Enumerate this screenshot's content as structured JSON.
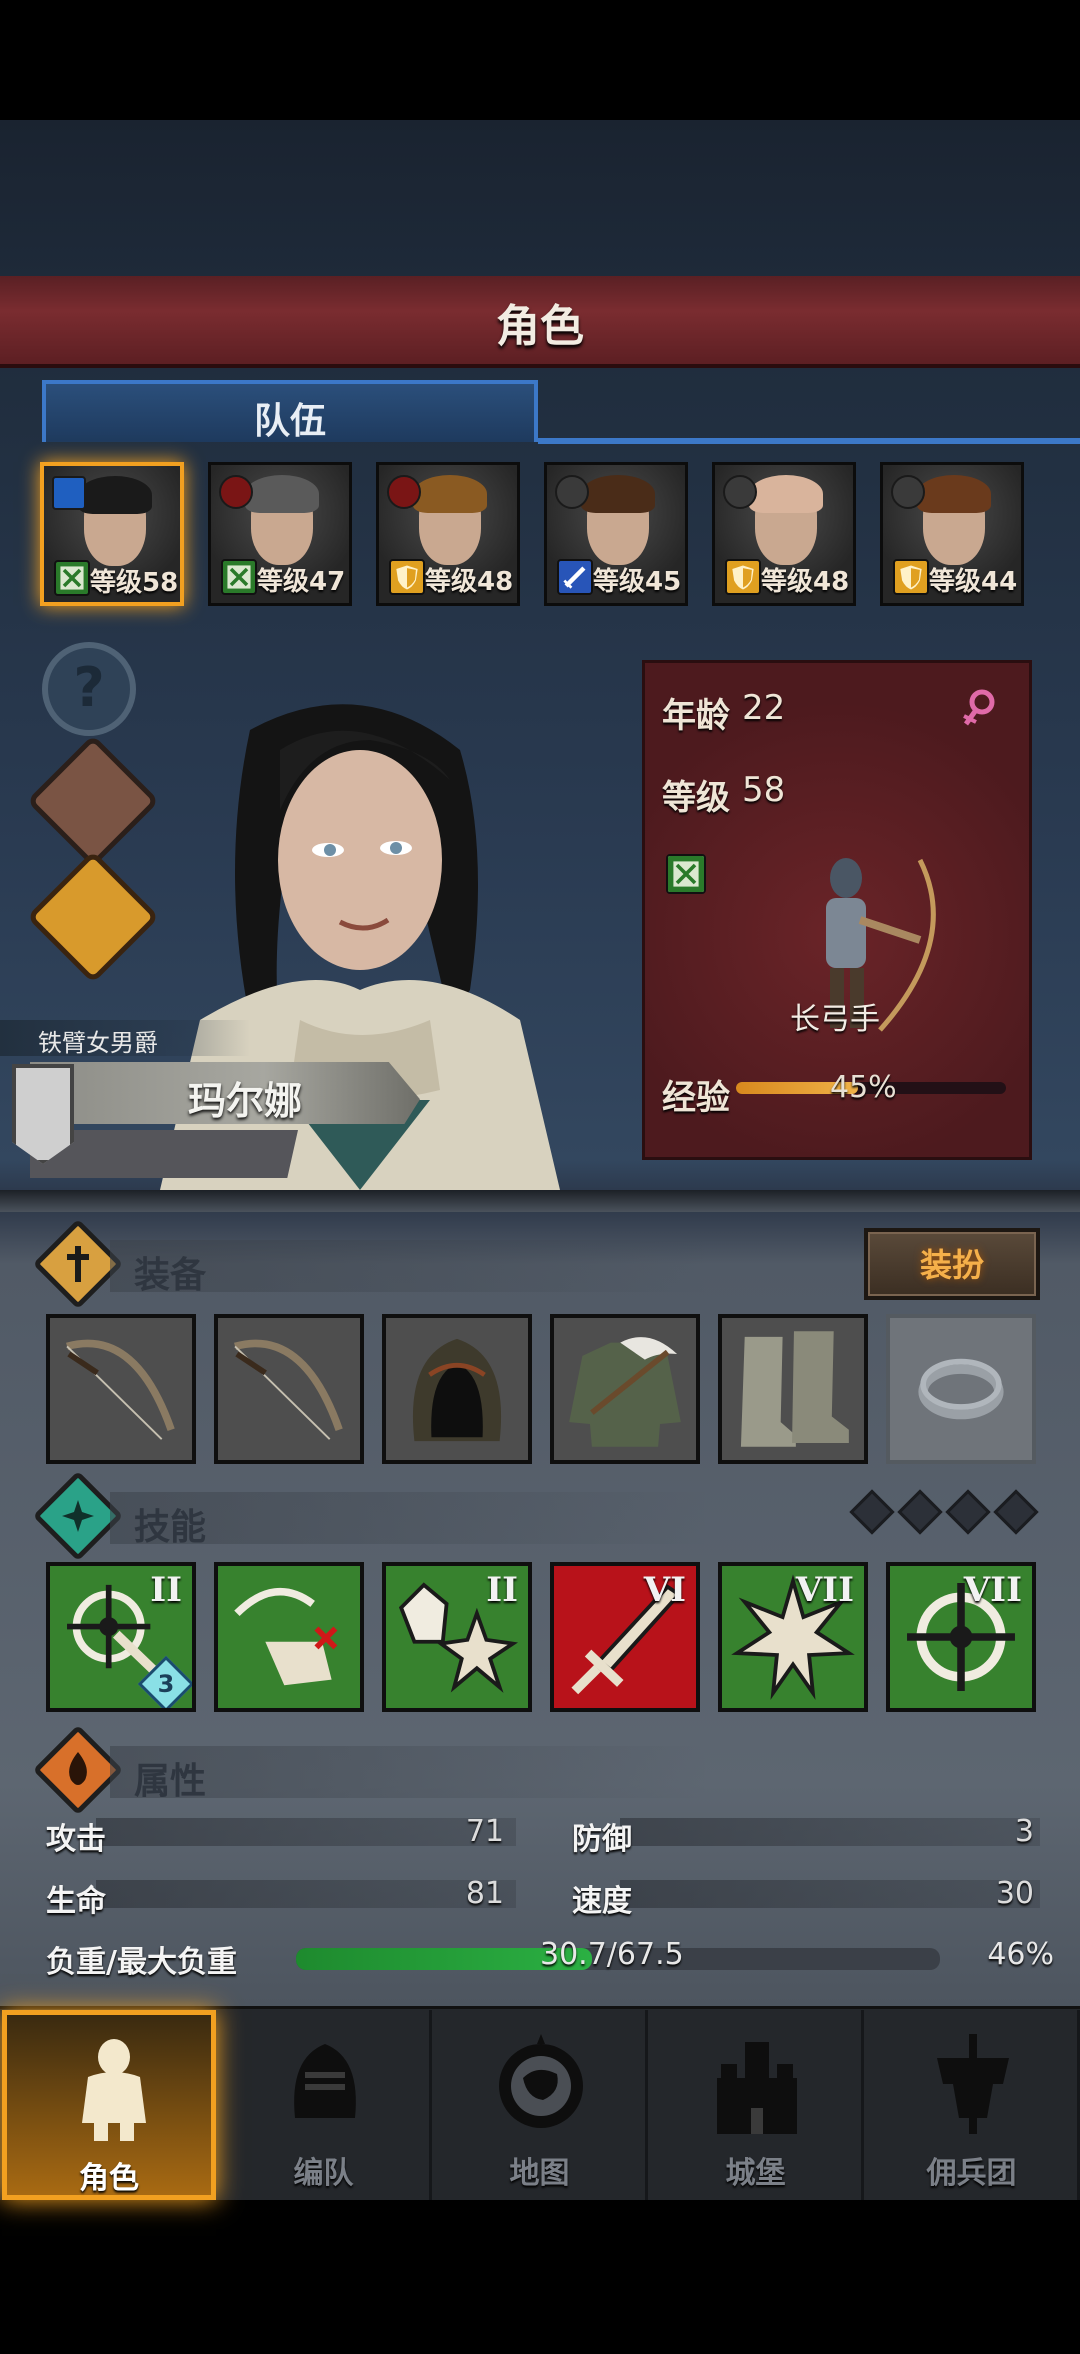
{
  "header": {
    "title": "角色"
  },
  "tabs": [
    {
      "label": "队伍",
      "active": true
    }
  ],
  "party": [
    {
      "level_prefix": "等级",
      "level": "58",
      "class_icon": "bow-icon",
      "class_color": "#2a7a2a",
      "role_icon": "flag-icon",
      "hair": "#1a1a1a",
      "selected": true
    },
    {
      "level_prefix": "等级",
      "level": "47",
      "class_icon": "bow-icon",
      "class_color": "#2a7a2a",
      "role_icon": "helmet-icon",
      "hair": "#5a5a5a"
    },
    {
      "level_prefix": "等级",
      "level": "48",
      "class_icon": "shield-icon",
      "class_color": "#e0a020",
      "role_icon": "helmet-icon",
      "hair": "#8a5a22"
    },
    {
      "level_prefix": "等级",
      "level": "45",
      "class_icon": "sword-icon",
      "class_color": "#2855b8",
      "role_icon": "helmet-icon",
      "hair": "#4a2c18"
    },
    {
      "level_prefix": "等级",
      "level": "48",
      "class_icon": "shield-icon",
      "class_color": "#e0a020",
      "role_icon": "helmet-icon",
      "hair": "#d9b49c"
    },
    {
      "level_prefix": "等级",
      "level": "44",
      "class_icon": "shield-icon",
      "class_color": "#e0a020",
      "role_icon": "helmet-icon",
      "hair": "#6a3a1c"
    }
  ],
  "character": {
    "title": "铁臂女男爵",
    "name": "玛尔娜",
    "age_label": "年龄",
    "age": "22",
    "level_label": "等级",
    "level": "58",
    "class_name": "长弓手",
    "exp_label": "经验",
    "exp_percent": "45%",
    "exp_fraction": 0.45,
    "gender_icon": "female-icon"
  },
  "equipment": {
    "title": "装备",
    "dress_button": "装扮",
    "slots": [
      {
        "item": "longbow-icon",
        "empty": false
      },
      {
        "item": "longbow-icon",
        "empty": false
      },
      {
        "item": "hood-icon",
        "empty": false
      },
      {
        "item": "tunic-icon",
        "empty": false
      },
      {
        "item": "boots-icon",
        "empty": false
      },
      {
        "item": "ring-icon",
        "empty": true
      }
    ]
  },
  "skills": {
    "title": "技能",
    "items": [
      {
        "icon": "aimed-shot-icon",
        "rank": "II",
        "count": "3",
        "color": "green"
      },
      {
        "icon": "stun-arrow-icon",
        "rank": "",
        "count": "",
        "color": "green"
      },
      {
        "icon": "gem-burst-icon",
        "rank": "II",
        "count": "",
        "color": "green"
      },
      {
        "icon": "dagger-icon",
        "rank": "VI",
        "count": "",
        "color": "red"
      },
      {
        "icon": "burst-icon",
        "rank": "VII",
        "count": "",
        "color": "green"
      },
      {
        "icon": "crosshair-icon",
        "rank": "VII",
        "count": "",
        "color": "green"
      }
    ]
  },
  "attributes": {
    "title": "属性",
    "attack_label": "攻击",
    "attack": "71",
    "defense_label": "防御",
    "defense": "3",
    "health_label": "生命",
    "health": "81",
    "speed_label": "速度",
    "speed": "30",
    "load_label": "负重/最大负重",
    "load_value": "30.7/67.5",
    "load_percent": "46%",
    "load_fraction": 0.46
  },
  "nav": [
    {
      "label": "角色",
      "icon": "knight-icon",
      "active": true
    },
    {
      "label": "编队",
      "icon": "helmet-icon",
      "active": false
    },
    {
      "label": "地图",
      "icon": "compass-map-icon",
      "active": false
    },
    {
      "label": "城堡",
      "icon": "castle-icon",
      "active": false
    },
    {
      "label": "佣兵团",
      "icon": "banner-icon",
      "active": false
    }
  ],
  "colors": {
    "accent": "#f2a020",
    "tab_blue": "#3c78c8",
    "panel_red": "#5a1c20",
    "exp_orange": "#f0b248",
    "load_green": "#2bb043"
  }
}
